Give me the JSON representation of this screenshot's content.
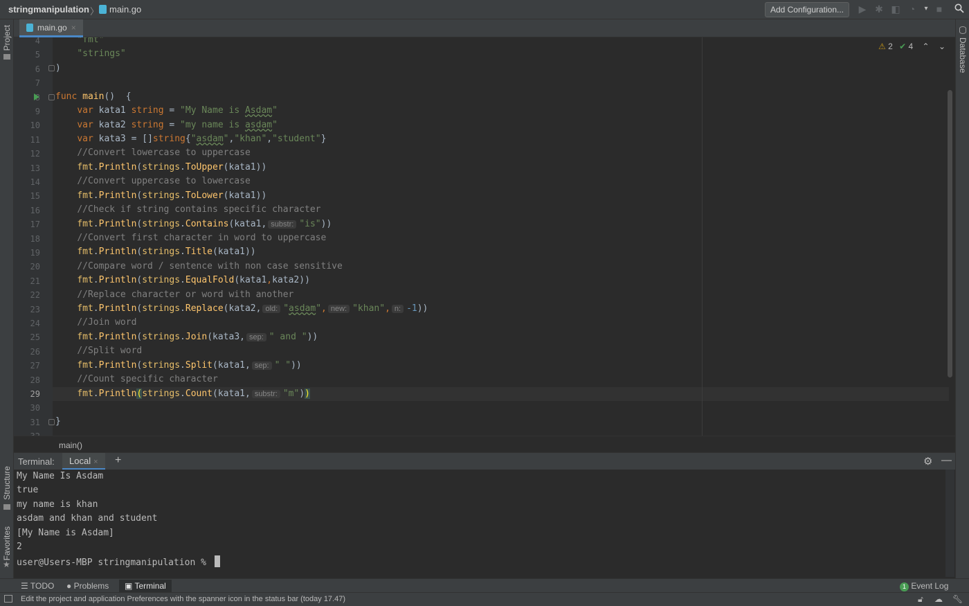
{
  "titlebar": {
    "project": "stringmanipulation",
    "separator": "〉",
    "file": "main.go",
    "add_configuration": "Add Configuration..."
  },
  "sidebars": {
    "left_top": "Project",
    "left_structure": "Structure",
    "left_favorites": "Favorites",
    "right_top": "Database"
  },
  "editor": {
    "tab_label": "main.go",
    "inspections": {
      "warnings": "2",
      "ok": "4"
    },
    "line_numbers": [
      "4",
      "5",
      "6",
      "7",
      "8",
      "9",
      "10",
      "11",
      "12",
      "13",
      "14",
      "15",
      "16",
      "17",
      "18",
      "19",
      "20",
      "21",
      "22",
      "23",
      "24",
      "25",
      "26",
      "27",
      "28",
      "29",
      "30",
      "31",
      "32"
    ],
    "current_line": "29",
    "breadcrumb": "main()"
  },
  "terminal": {
    "title": "Terminal:",
    "tab": "Local",
    "output": [
      "My Name Is Asdam",
      "true",
      "my name is khan",
      "asdam and khan and student",
      "[My Name is Asdam]",
      "2"
    ],
    "prompt": "user@Users-MBP stringmanipulation % "
  },
  "tools": {
    "todo": "TODO",
    "problems": "Problems",
    "terminal": "Terminal",
    "event_log": "Event Log",
    "event_count": "1"
  },
  "status": {
    "message": "Edit the project and application Preferences with the spanner icon in the status bar (today 17.47)"
  },
  "colors": {
    "keyword": "#cc7832",
    "string": "#6a8759",
    "comment": "#808080",
    "function": "#ffc66d",
    "accent": "#4a88c7"
  }
}
